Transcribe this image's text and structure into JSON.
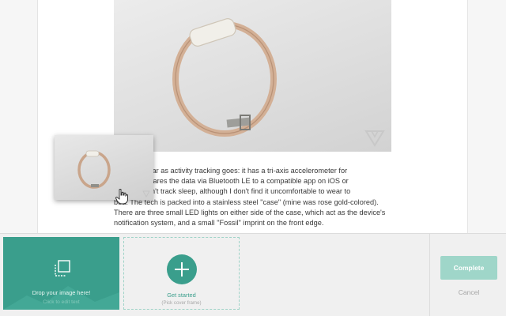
{
  "article": {
    "body_lines": [
      "ty basic as far as activity tracking goes: it has a tri-axis accelerometer for",
      "ps, and it shares the data via Bluetooth LE to a compatible app on iOS or",
      "ces. It doesn't track sleep, although I don't find it uncomfortable to wear to",
      "bed. The tech is packed into a stainless steel \"case\" (mine was rose gold-colored).",
      "There are three small LED lights on either side of the case, which act as the device's",
      "notification system, and a small \"Fossil\" imprint on the front edge."
    ]
  },
  "cover_picker": {
    "dropzone": {
      "primary_text": "Drop your image here!",
      "secondary_text": "Click to edit text"
    },
    "get_started": {
      "label": "Get started",
      "sublabel": "(Pick cover frame)"
    },
    "actions": {
      "complete_label": "Complete",
      "cancel_label": "Cancel"
    }
  },
  "colors": {
    "accent": "#3a9e8c",
    "complete_button": "#9fd6c9"
  }
}
